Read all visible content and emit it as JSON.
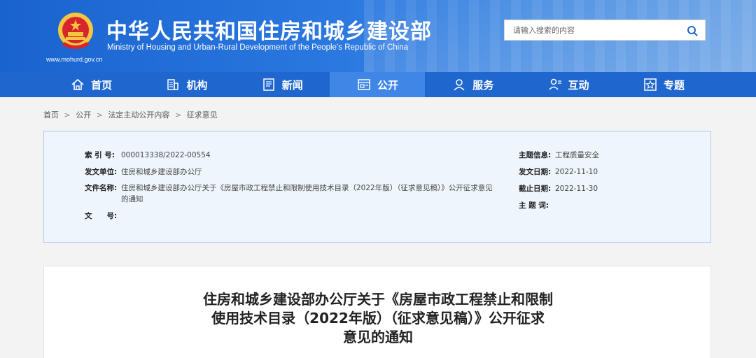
{
  "header": {
    "title": "中华人民共和国住房和城乡建设部",
    "subtitle": "Ministry of Housing and Urban-Rural Development of the People’s Republic of China",
    "url": "www.mohurd.gov.cn",
    "search_placeholder": "请输入搜索的内容",
    "colors": {
      "primary": "#1f66cf",
      "active_tab": "#3f86e6"
    }
  },
  "nav": {
    "items": [
      {
        "label": "首页",
        "icon": "home-icon"
      },
      {
        "label": "机构",
        "icon": "building-icon"
      },
      {
        "label": "新闻",
        "icon": "news-icon"
      },
      {
        "label": "公开",
        "icon": "open-icon"
      },
      {
        "label": "服务",
        "icon": "service-icon"
      },
      {
        "label": "互动",
        "icon": "interact-icon"
      },
      {
        "label": "专题",
        "icon": "topic-icon"
      }
    ],
    "active": "公开"
  },
  "breadcrumb": [
    "首页",
    "公开",
    "法定主动公开内容",
    "征求意见"
  ],
  "info": {
    "index_label": "索 引 号:",
    "index_value": "000013338/2022-00554",
    "publisher_label": "发文单位:",
    "publisher_value": "住房和城乡建设部办公厅",
    "docname_label": "文件名称:",
    "docname_value": "住房和城乡建设部办公厅关于《房屋市政工程禁止和限制使用技术目录（2022年版）（征求意见稿）》公开征求意见的通知",
    "docno_label": "文　　号:",
    "docno_value": "",
    "subject_label": "主题信息:",
    "subject_value": "工程质量安全",
    "date_label": "发文日期:",
    "date_value": "2022-11-10",
    "deadline_label": "截止日期:",
    "deadline_value": "2022-11-30",
    "keywords_label": "主 题 词:",
    "keywords_value": ""
  },
  "article": {
    "title_line1": "住房和城乡建设部办公厅关于《房屋市政工程禁止和限制",
    "title_line2": "使用技术目录（2022年版）（征求意见稿）》公开征求",
    "title_line3": "意见的通知"
  }
}
